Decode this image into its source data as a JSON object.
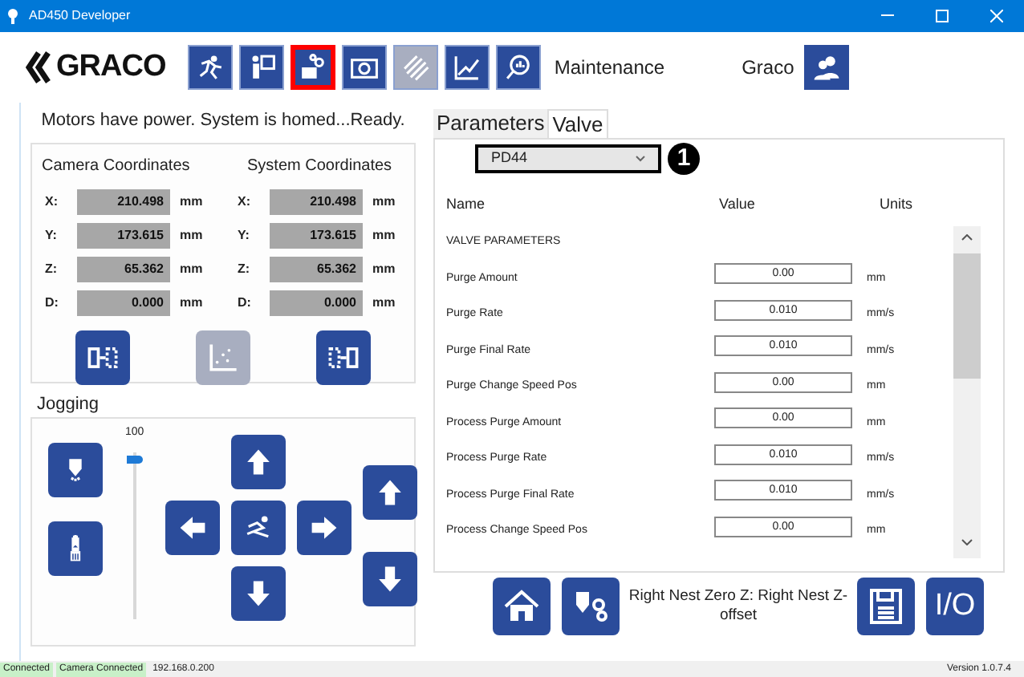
{
  "window": {
    "title": "AD450 Developer"
  },
  "toolbar": {
    "logo": "GRACO",
    "buttons": [
      {
        "kind": "run",
        "selected": false,
        "disabled": false
      },
      {
        "kind": "teach",
        "selected": false,
        "disabled": false
      },
      {
        "kind": "maintenance",
        "selected": true,
        "disabled": false
      },
      {
        "kind": "camera",
        "selected": false,
        "disabled": false
      },
      {
        "kind": "stripes",
        "selected": false,
        "disabled": true
      },
      {
        "kind": "chart",
        "selected": false,
        "disabled": false
      },
      {
        "kind": "inspect",
        "selected": false,
        "disabled": false
      }
    ],
    "mode": "Maintenance",
    "user": "Graco"
  },
  "status_message": "Motors have power. System is homed...Ready.",
  "coordinates": [
    {
      "title": "Camera Coordinates",
      "rows": [
        {
          "axis": "X:",
          "value": "210.498",
          "unit": "mm"
        },
        {
          "axis": "Y:",
          "value": "173.615",
          "unit": "mm"
        },
        {
          "axis": "Z:",
          "value": "65.362",
          "unit": "mm"
        },
        {
          "axis": "D:",
          "value": "0.000",
          "unit": "mm"
        }
      ]
    },
    {
      "title": "System Coordinates",
      "rows": [
        {
          "axis": "X:",
          "value": "210.498",
          "unit": "mm"
        },
        {
          "axis": "Y:",
          "value": "173.615",
          "unit": "mm"
        },
        {
          "axis": "Z:",
          "value": "65.362",
          "unit": "mm"
        },
        {
          "axis": "D:",
          "value": "0.000",
          "unit": "mm"
        }
      ]
    }
  ],
  "coord_buttons": [
    {
      "kind": "to-right",
      "disabled": false
    },
    {
      "kind": "scatter",
      "disabled": true
    },
    {
      "kind": "to-left",
      "disabled": false
    }
  ],
  "jogging": {
    "title": "Jogging",
    "speed": {
      "reading": "100",
      "level": 0.97
    }
  },
  "tabs": [
    {
      "label": "Parameters",
      "selected": false
    },
    {
      "label": "Valve",
      "selected": true
    }
  ],
  "valve_select": {
    "value": "PD44"
  },
  "callout": "1",
  "table": {
    "columns": [
      "Name",
      "Value",
      "Units"
    ],
    "section": "VALVE PARAMETERS",
    "rows": [
      {
        "name": "Purge Amount",
        "value": "0.00",
        "unit": "mm"
      },
      {
        "name": "Purge Rate",
        "value": "0.010",
        "unit": "mm/s"
      },
      {
        "name": "Purge Final Rate",
        "value": "0.010",
        "unit": "mm/s"
      },
      {
        "name": "Purge Change Speed Pos",
        "value": "0.00",
        "unit": "mm"
      },
      {
        "name": "Process Purge Amount",
        "value": "0.00",
        "unit": "mm"
      },
      {
        "name": "Process Purge Rate",
        "value": "0.010",
        "unit": "mm/s"
      },
      {
        "name": "Process Purge Final Rate",
        "value": "0.010",
        "unit": "mm/s"
      },
      {
        "name": "Process Change Speed Pos",
        "value": "0.00",
        "unit": "mm"
      }
    ]
  },
  "message": "Right Nest Zero Z: Right Nest Z-offset",
  "io_button": "I/O",
  "status_bar": {
    "items": [
      "Connected",
      "Camera Connected"
    ],
    "address": "192.168.0.200",
    "version": "Version 1.0.7.4"
  }
}
